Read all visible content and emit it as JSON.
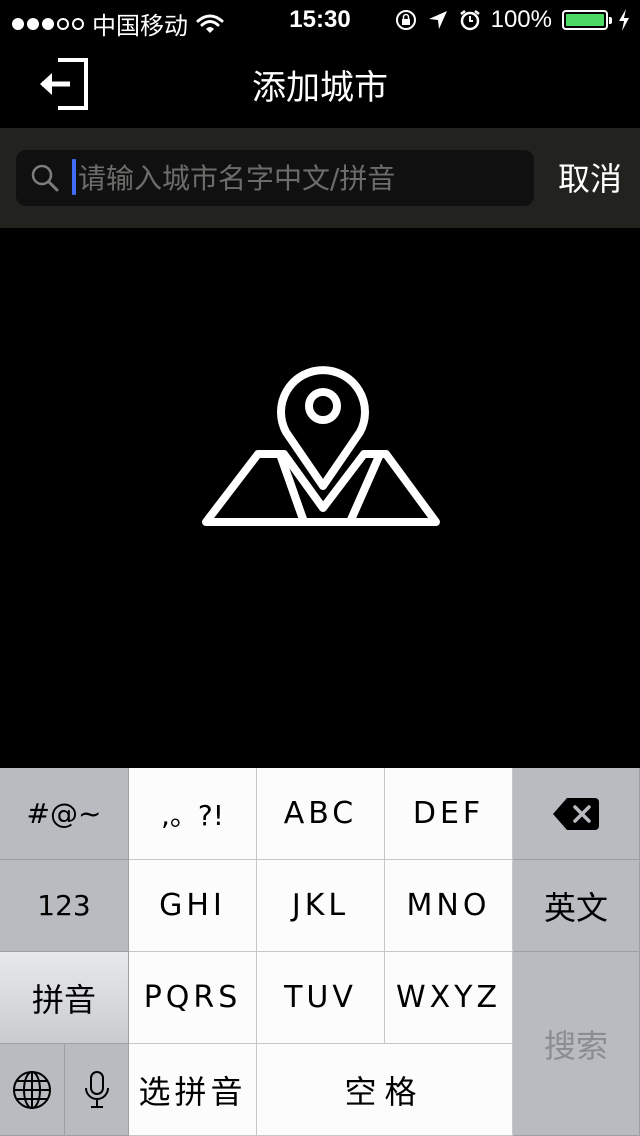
{
  "status_bar": {
    "carrier": "中国移动",
    "time": "15:30",
    "battery": "100%",
    "battery_level": 1.0,
    "battery_color": "#4cd964",
    "icons": [
      "signal-dots-icon",
      "wifi-icon",
      "orientation-lock-icon",
      "location-arrow-icon",
      "alarm-icon",
      "battery-icon",
      "charging-bolt-icon"
    ]
  },
  "nav": {
    "title": "添加城市",
    "back_icon": "exit-arrow-icon"
  },
  "search": {
    "placeholder": "请输入城市名字中文/拼音",
    "value": "",
    "cancel_label": "取消",
    "icon": "search-icon",
    "caret_color": "#3f6cf2"
  },
  "empty_state": {
    "icon": "map-pin-icon"
  },
  "keyboard": {
    "rows": [
      [
        "#@~",
        ",。?!",
        "ABC",
        "DEF",
        "delete-icon"
      ],
      [
        "123",
        "GHI",
        "JKL",
        "MNO",
        "英文"
      ],
      [
        "拼音",
        "PQRS",
        "TUV",
        "WXYZ",
        "搜索"
      ],
      [
        "globe-icon",
        "microphone-icon",
        "选拼音",
        "空格"
      ]
    ],
    "keys": {
      "symbols": "#@~",
      "punct": ",。?!",
      "abc": "ABC",
      "def": "DEF",
      "numbers": "123",
      "ghi": "GHI",
      "jkl": "JKL",
      "mno": "MNO",
      "english": "英文",
      "pinyin": "拼音",
      "pqrs": "PQRS",
      "tuv": "TUV",
      "wxyz": "WXYZ",
      "search": "搜索",
      "select_pinyin": "选拼音",
      "space": "空格"
    }
  }
}
